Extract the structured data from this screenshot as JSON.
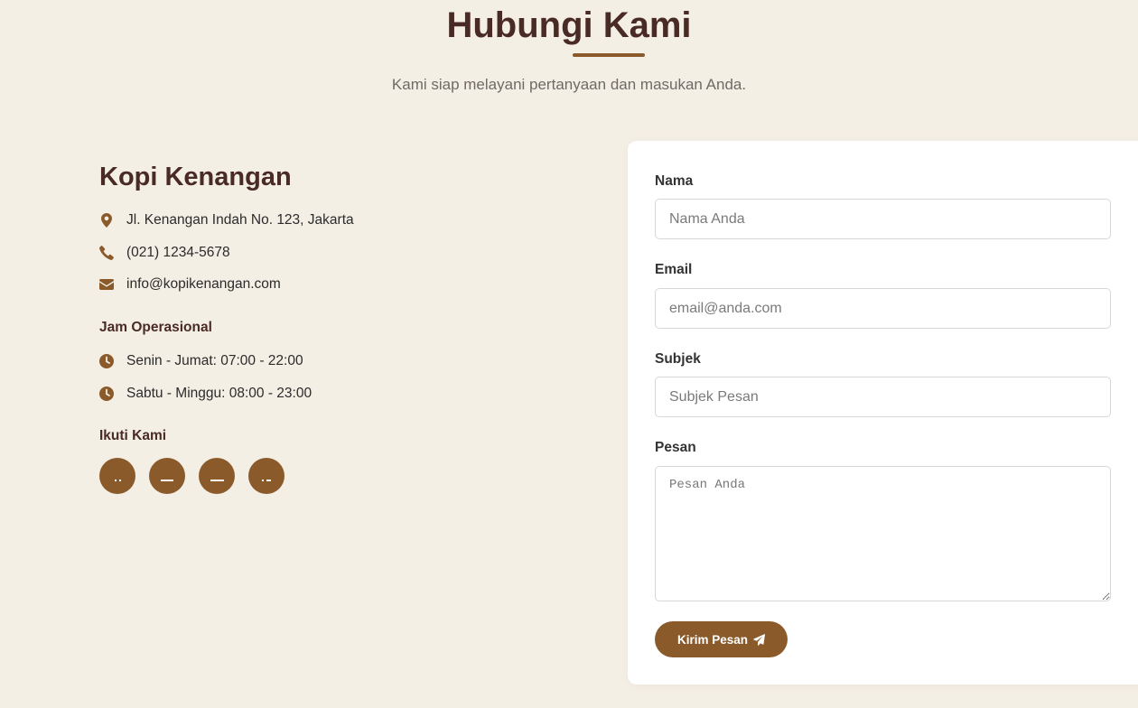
{
  "section": {
    "title": "Hubungi Kami",
    "subtitle": "Kami siap melayani pertanyaan dan masukan Anda."
  },
  "info": {
    "brand": "Kopi Kenangan",
    "address": "Jl. Kenangan Indah No. 123, Jakarta",
    "phone": "(021) 1234-5678",
    "email": "info@kopikenangan.com",
    "hours_heading": "Jam Operasional",
    "hours": [
      "Senin - Jumat: 07:00 - 22:00",
      "Sabtu - Minggu: 08:00 - 23:00"
    ],
    "social_heading": "Ikuti Kami",
    "socials": [
      "facebook-icon",
      "twitter-icon",
      "instagram-icon",
      "tiktok-icon"
    ]
  },
  "form": {
    "name_label": "Nama",
    "name_placeholder": "Nama Anda",
    "email_label": "Email",
    "email_placeholder": "email@anda.com",
    "subject_label": "Subjek",
    "subject_placeholder": "Subjek Pesan",
    "message_label": "Pesan",
    "message_placeholder": "Pesan Anda",
    "submit_label": "Kirim Pesan"
  },
  "colors": {
    "accent": "#8b5a2b",
    "heading": "#4a2a24",
    "background": "#f4efe5"
  }
}
